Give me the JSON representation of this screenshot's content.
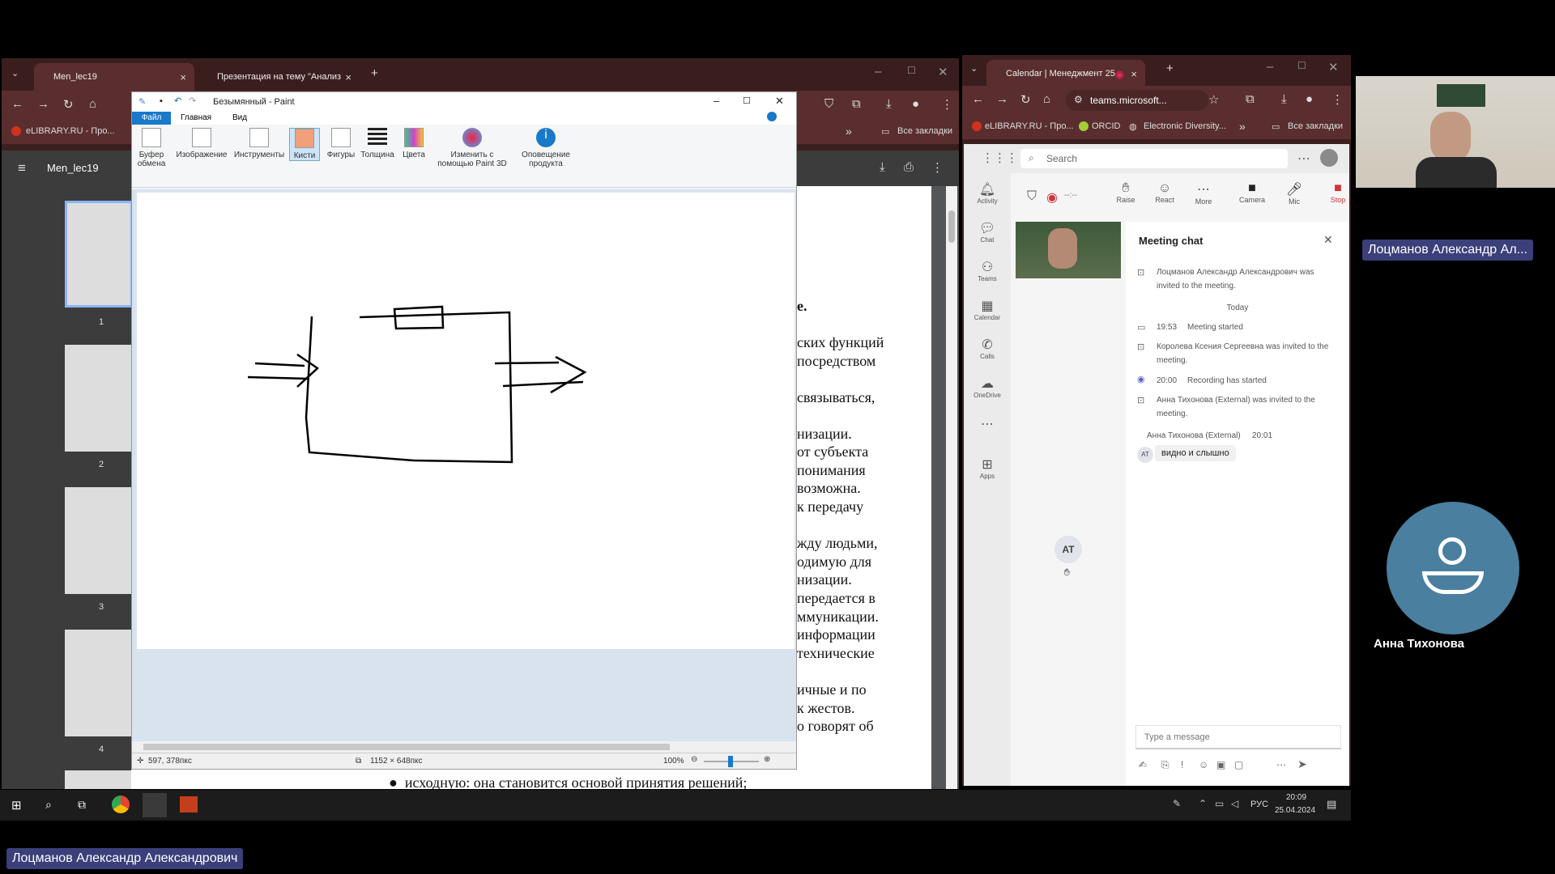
{
  "chrome_left": {
    "tabs": [
      {
        "label": "Men_lec19",
        "active": true
      },
      {
        "label": "Презентация на тему \"Анализ",
        "active": false
      }
    ],
    "bookmarks": [
      "eLIBRARY.RU - Про...",
      "Все закладки"
    ]
  },
  "pdf": {
    "file_name": "Men_lec19",
    "thumbnail_numbers": [
      "1",
      "2",
      "3",
      "4"
    ],
    "page_lines": [
      "е.",
      "ских функций",
      "посредством",
      "связываться,",
      "низации.",
      "от субъекта",
      "понимания",
      "возможна.",
      "к передачу",
      "жду людьми,",
      "одимую для",
      "низации.",
      "передается в",
      "ммуникации.",
      "информации",
      "технические",
      "ичные и по",
      "к жестов.",
      "о говорят об"
    ],
    "bottom_line": "исходную: она становится основой принятия решений;"
  },
  "paint": {
    "title": "Безымянный - Paint",
    "menu": [
      "Файл",
      "Главная",
      "Вид"
    ],
    "ribbon": [
      {
        "label": "Буфер\nобмена"
      },
      {
        "label": "Изображение"
      },
      {
        "label": "Инструменты"
      },
      {
        "label": "Кисти"
      },
      {
        "label": "Фигуры"
      },
      {
        "label": "Толщина"
      },
      {
        "label": "Цвета"
      },
      {
        "label": "Изменить с\nпомощью Paint 3D"
      },
      {
        "label": "Оповещение\nпродукта"
      }
    ],
    "status": {
      "cursor": "597, 378пкс",
      "size": "1152 × 648пкс",
      "zoom": "100%"
    }
  },
  "chrome_right": {
    "tab_label": "Calendar | Менеджмент 25",
    "address": "teams.microsoft...",
    "bookmarks": [
      "eLIBRARY.RU - Про...",
      "ORCID",
      "Electronic Diversity...",
      "Все закладки"
    ]
  },
  "teams": {
    "search_placeholder": "Search",
    "rail": [
      "Activity",
      "Chat",
      "Teams",
      "Calendar",
      "Calls",
      "OneDrive",
      "Apps"
    ],
    "controls": [
      "Raise",
      "React",
      "More",
      "Camera",
      "Mic",
      "Stop"
    ],
    "timer": "--:--",
    "chat_title": "Meeting chat",
    "messages": [
      {
        "text": "Лоцманов Александр Александрович was invited to the meeting."
      },
      {
        "text": "Today",
        "kind": "separator"
      },
      {
        "time": "19:53",
        "text": "Meeting started"
      },
      {
        "text": "Королева Ксения Сергеевна was invited to the meeting."
      },
      {
        "time": "20:00",
        "text": "Recording has started"
      },
      {
        "text": "Анна Тихонова (External) was invited to the meeting."
      }
    ],
    "last_message": {
      "author": "Анна Тихонова (External)",
      "time": "20:01",
      "avatar": "AT",
      "text": "видно и слышно"
    },
    "center_avatar": "AT",
    "compose_placeholder": "Type a message"
  },
  "taskbar": {
    "lang": "РУС",
    "time": "20:09",
    "date": "25.04.2024"
  },
  "participants": {
    "presenter_name": "Лоцманов Александр Ал...",
    "second_name": "Анна Тихонова",
    "bottom_name": "Лоцманов Александр Александрович"
  }
}
